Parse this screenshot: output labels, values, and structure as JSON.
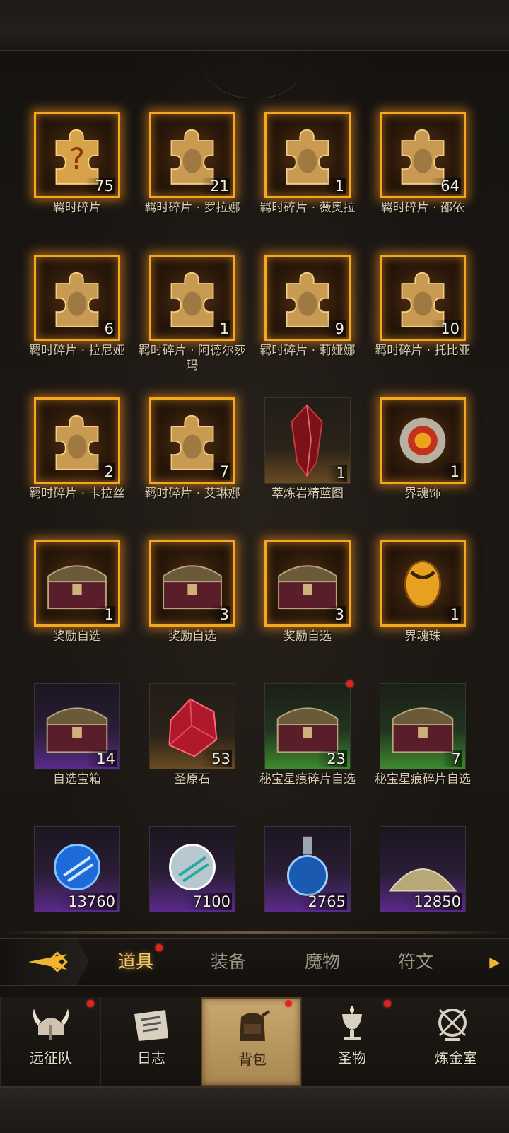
{
  "items": [
    {
      "label": "羁时碎片",
      "count": "75",
      "icon": "puzzle-question-icon",
      "frame": "gold"
    },
    {
      "label": "羁时碎片 · 罗拉娜",
      "count": "21",
      "icon": "puzzle-portrait-icon",
      "frame": "gold"
    },
    {
      "label": "羁时碎片 · 薇奥拉",
      "count": "1",
      "icon": "puzzle-portrait-icon",
      "frame": "gold"
    },
    {
      "label": "羁时碎片 · 邵依",
      "count": "64",
      "icon": "puzzle-portrait-icon",
      "frame": "gold"
    },
    {
      "label": "羁时碎片 · 拉尼娅",
      "count": "6",
      "icon": "puzzle-portrait-icon",
      "frame": "gold"
    },
    {
      "label": "羁时碎片 · 阿德尔莎玛",
      "count": "1",
      "icon": "puzzle-portrait-icon",
      "frame": "gold"
    },
    {
      "label": "羁时碎片 · 莉娅娜",
      "count": "9",
      "icon": "puzzle-portrait-icon",
      "frame": "gold"
    },
    {
      "label": "羁时碎片 · 托比亚",
      "count": "10",
      "icon": "puzzle-portrait-icon",
      "frame": "gold"
    },
    {
      "label": "羁时碎片 · 卡拉丝",
      "count": "2",
      "icon": "puzzle-portrait-icon",
      "frame": "gold"
    },
    {
      "label": "羁时碎片 · 艾琳娜",
      "count": "7",
      "icon": "puzzle-portrait-icon",
      "frame": "gold"
    },
    {
      "label": "萃炼岩精蓝图",
      "count": "1",
      "icon": "red-crystal-icon",
      "frame": "plain"
    },
    {
      "label": "界魂饰",
      "count": "1",
      "icon": "sun-amulet-icon",
      "frame": "gold"
    },
    {
      "label": "奖励自选",
      "count": "1",
      "icon": "treasure-chest-icon",
      "frame": "gold"
    },
    {
      "label": "奖励自选",
      "count": "3",
      "icon": "treasure-chest-icon",
      "frame": "gold"
    },
    {
      "label": "奖励自选",
      "count": "3",
      "icon": "treasure-chest-icon",
      "frame": "gold"
    },
    {
      "label": "界魂珠",
      "count": "1",
      "icon": "amber-orb-icon",
      "frame": "gold"
    },
    {
      "label": "自选宝箱",
      "count": "14",
      "icon": "treasure-chest-icon",
      "frame": "purple"
    },
    {
      "label": "圣原石",
      "count": "53",
      "icon": "ruby-gem-icon",
      "frame": "plain"
    },
    {
      "label": "秘宝星痕碎片自选",
      "count": "23",
      "icon": "treasure-chest-icon",
      "frame": "green",
      "badge": true
    },
    {
      "label": "秘宝星痕碎片自选",
      "count": "7",
      "icon": "treasure-chest-icon",
      "frame": "green"
    },
    {
      "label": "",
      "count": "13760",
      "icon": "blue-orb-icon",
      "frame": "purple"
    },
    {
      "label": "",
      "count": "7100",
      "icon": "white-orb-icon",
      "frame": "purple"
    },
    {
      "label": "",
      "count": "2765",
      "icon": "potion-flask-icon",
      "frame": "purple"
    },
    {
      "label": "",
      "count": "12850",
      "icon": "dust-pile-icon",
      "frame": "purple"
    }
  ],
  "tabs": [
    {
      "label": "道具",
      "active": true,
      "badge": true
    },
    {
      "label": "装备",
      "active": false
    },
    {
      "label": "魔物",
      "active": false
    },
    {
      "label": "符文",
      "active": false
    }
  ],
  "nav": [
    {
      "label": "远征队",
      "icon": "viking-helmet-icon",
      "badge": true
    },
    {
      "label": "日志",
      "icon": "scroll-icon",
      "badge": false
    },
    {
      "label": "背包",
      "icon": "backpack-icon",
      "badge": true,
      "active": true
    },
    {
      "label": "圣物",
      "icon": "chalice-icon",
      "badge": true
    },
    {
      "label": "炼金室",
      "icon": "alchemy-icon",
      "badge": false
    }
  ],
  "colors": {
    "gold_frame": "#f3a820",
    "active_tab": "#f2c86a",
    "badge": "#e0231d",
    "active_nav": "#c9a770"
  }
}
